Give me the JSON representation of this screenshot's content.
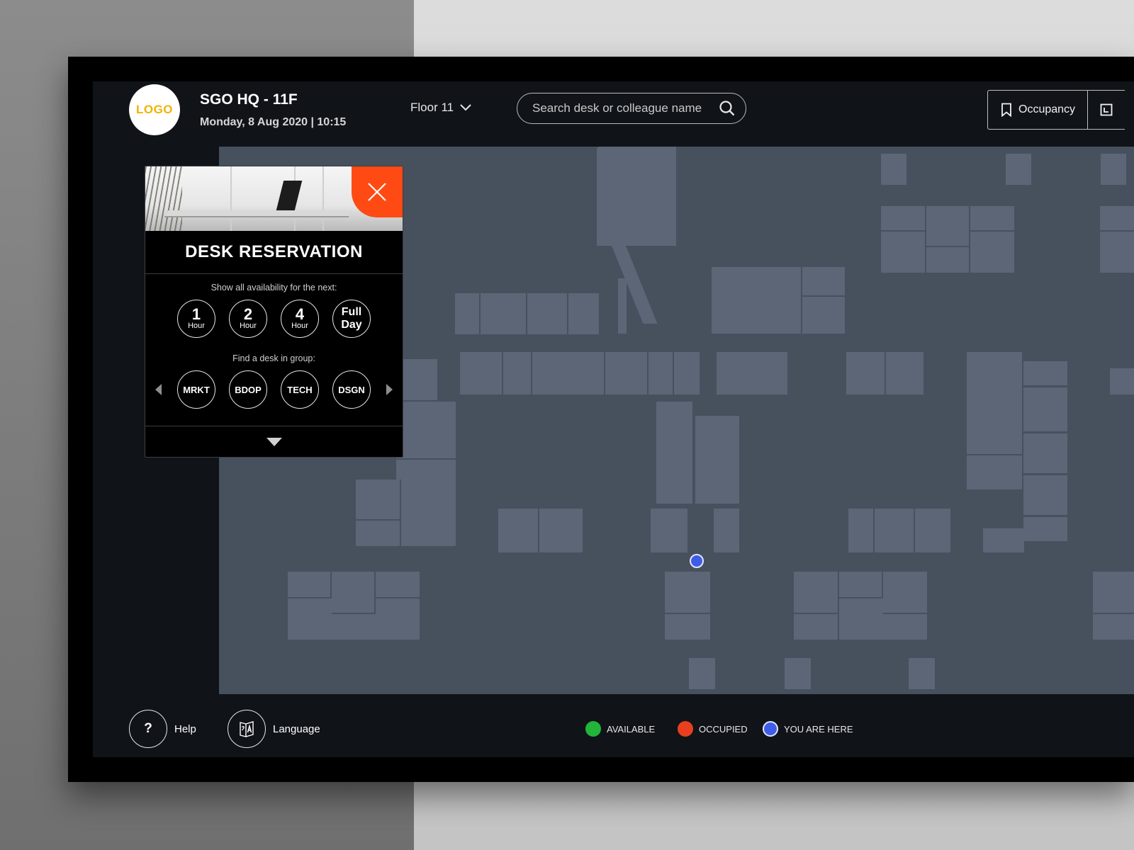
{
  "header": {
    "logo_text": "LOGO",
    "site_title": "SGO HQ - 11F",
    "site_datetime": "Monday, 8 Aug 2020 | 10:15",
    "floor_label": "Floor 11",
    "search_placeholder": "Search desk or colleague name",
    "occupancy_label": "Occupancy"
  },
  "panel": {
    "title": "DESK RESERVATION",
    "availability_label": "Show all availability for the next:",
    "durations": [
      {
        "num": "1",
        "unit": "Hour"
      },
      {
        "num": "2",
        "unit": "Hour"
      },
      {
        "num": "4",
        "unit": "Hour"
      },
      {
        "text": "Full Day",
        "line1": "Full",
        "line2": "Day"
      }
    ],
    "group_label": "Find a desk in group:",
    "groups": [
      "MRKT",
      "BDOP",
      "TECH",
      "DSGN"
    ]
  },
  "bottom": {
    "help_symbol": "?",
    "help_label": "Help",
    "language_label": "Language"
  },
  "legend": [
    {
      "label": "AVAILABLE",
      "color": "#22b53a"
    },
    {
      "label": "OCCUPIED",
      "color": "#e8401e"
    },
    {
      "label": "YOU ARE HERE",
      "color": "#3e5ce6"
    }
  ],
  "colors": {
    "accent": "#ff4a14",
    "logo": "#f0b400",
    "map_floor": "#47505d",
    "map_room": "#5c6677",
    "screen_bg": "#101419"
  },
  "icons": [
    "chevron-down-icon",
    "search-icon",
    "bookmark-icon",
    "calendar-icon",
    "close-icon",
    "translate-icon"
  ]
}
